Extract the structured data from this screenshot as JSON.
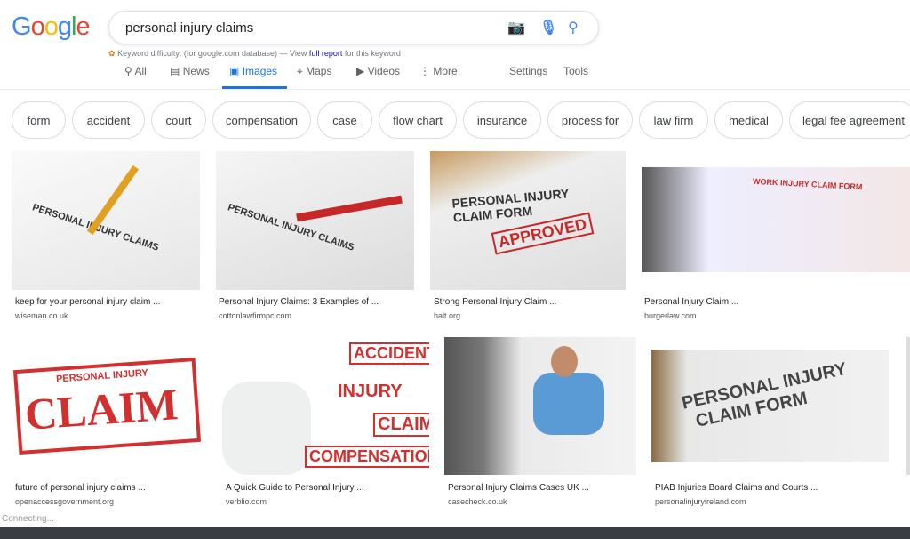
{
  "logo": "Google",
  "search": {
    "query": "personal injury claims",
    "icons": [
      "camera-icon",
      "microphone-icon",
      "search-icon"
    ]
  },
  "keyword": {
    "prefix": "Keyword difficulty:  (for google.com database) — View ",
    "link": "full report",
    "suffix": " for this keyword"
  },
  "tabs": [
    {
      "label": "All",
      "icon": "search-icon"
    },
    {
      "label": "News",
      "icon": "news-icon"
    },
    {
      "label": "Images",
      "icon": "image-icon"
    },
    {
      "label": "Maps",
      "icon": "map-icon"
    },
    {
      "label": "Videos",
      "icon": "play-icon"
    },
    {
      "label": "More",
      "icon": "more-icon"
    },
    {
      "label": "Settings"
    },
    {
      "label": "Tools"
    }
  ],
  "chips": [
    "form",
    "accident",
    "court",
    "compensation",
    "case",
    "flow chart",
    "insurance",
    "process for",
    "law firm",
    "medical",
    "legal fee agreement"
  ],
  "results": [
    {
      "title": "keep for your personal injury claim ...",
      "source": "wiseman.co.uk"
    },
    {
      "title": "Personal Injury Claims: 3 Examples of ...",
      "source": "cottonlawfirmpc.com"
    },
    {
      "title": "Strong Personal Injury Claim ...",
      "source": "halt.org"
    },
    {
      "title": "Personal Injury Claim ...",
      "source": "burgerlaw.com"
    },
    {
      "title": "future of personal injury claims ...",
      "source": "openaccessgovernment.org"
    },
    {
      "title": "A Quick Guide to Personal Injury ...",
      "source": "verblio.com"
    },
    {
      "title": "Personal Injury Claims Cases UK ...",
      "source": "casecheck.co.uk"
    },
    {
      "title": "PIAB Injuries Board Claims and Courts ...",
      "source": "personalinjuryireland.com"
    }
  ],
  "status": "Connecting...",
  "colors": {
    "accent": "#1a73e8",
    "link": "#1a0dab"
  }
}
